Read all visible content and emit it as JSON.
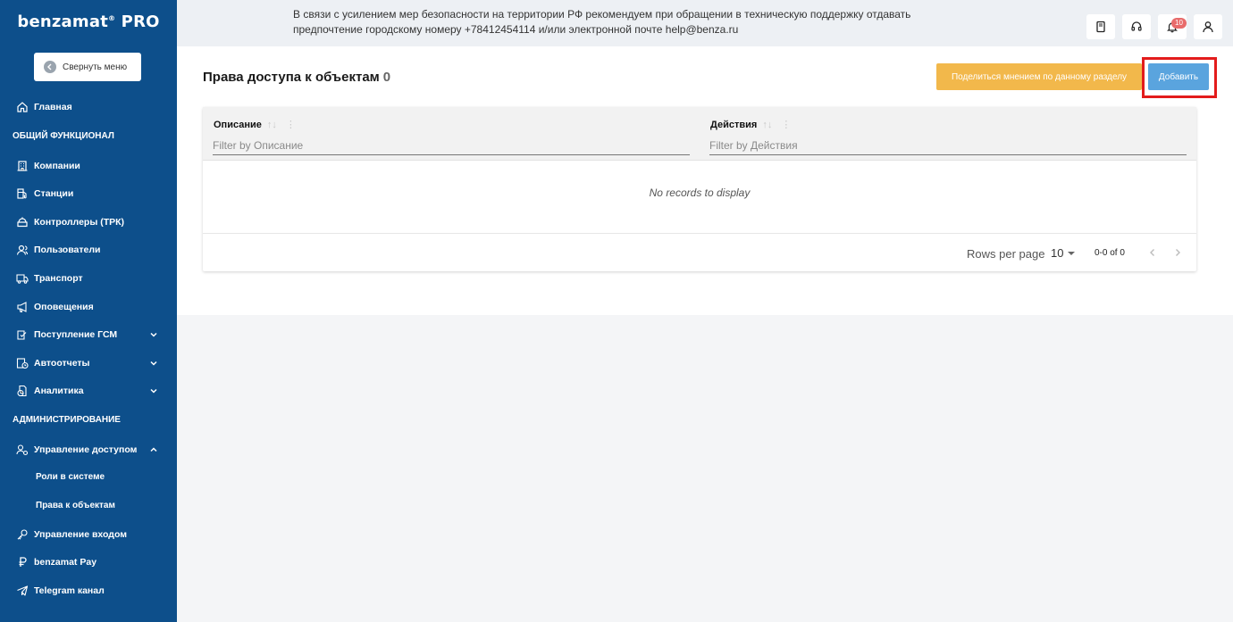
{
  "brand": {
    "name": "benzamat",
    "mark": "®",
    "suffix": "PRO"
  },
  "sidebar": {
    "collapse_label": "Свернуть меню",
    "items": [
      {
        "label": "Главная",
        "icon": "home-icon"
      },
      {
        "label": "Компании",
        "icon": "building-icon"
      },
      {
        "label": "Станции",
        "icon": "station-icon"
      },
      {
        "label": "Контроллеры (ТРК)",
        "icon": "controller-icon"
      },
      {
        "label": "Пользователи",
        "icon": "users-icon"
      },
      {
        "label": "Транспорт",
        "icon": "truck-icon"
      },
      {
        "label": "Оповещения",
        "icon": "megaphone-icon"
      },
      {
        "label": "Поступление ГСМ",
        "icon": "fuel-income-icon"
      },
      {
        "label": "Автоотчеты",
        "icon": "report-clock-icon"
      },
      {
        "label": "Аналитика",
        "icon": "analytics-icon"
      },
      {
        "label": "Управление доступом",
        "icon": "access-icon"
      },
      {
        "label": "Управление входом",
        "icon": "key-icon"
      },
      {
        "label": "benzamat Pay",
        "icon": "ruble-icon"
      },
      {
        "label": "Telegram канал",
        "icon": "telegram-icon"
      }
    ],
    "sections": [
      "ОБЩИЙ ФУНКЦИОНАЛ",
      "АДМИНИСТРИРОВАНИЕ"
    ],
    "sub_items": [
      "Роли в системе",
      "Права к объектам"
    ]
  },
  "header": {
    "notice_line1": "В связи с усилением мер безопасности на территории РФ рекомендуем при обращении в техническую поддержку отдавать",
    "notice_line2": "предпочтение городскому номеру +78412454114 и/или электронной почте help@benza.ru",
    "notifications_count": "10"
  },
  "page": {
    "title": "Права доступа к объектам",
    "count": "0",
    "share_label": "Поделиться мнением по данному разделу",
    "add_label": "Добавить"
  },
  "table": {
    "columns": [
      {
        "label": "Описание",
        "filter_placeholder": "Filter by Описание"
      },
      {
        "label": "Действия",
        "filter_placeholder": "Filter by Действия"
      }
    ],
    "empty_text": "No records to display",
    "rows_per_page_label": "Rows per page",
    "rows_per_page_value": "10",
    "range_text": "0-0 of 0"
  },
  "colors": {
    "sidebar_bg": "#0d4f8b",
    "share_button": "#f2b84b",
    "add_button": "#5aa4de",
    "highlight_frame": "#e31c1c"
  }
}
